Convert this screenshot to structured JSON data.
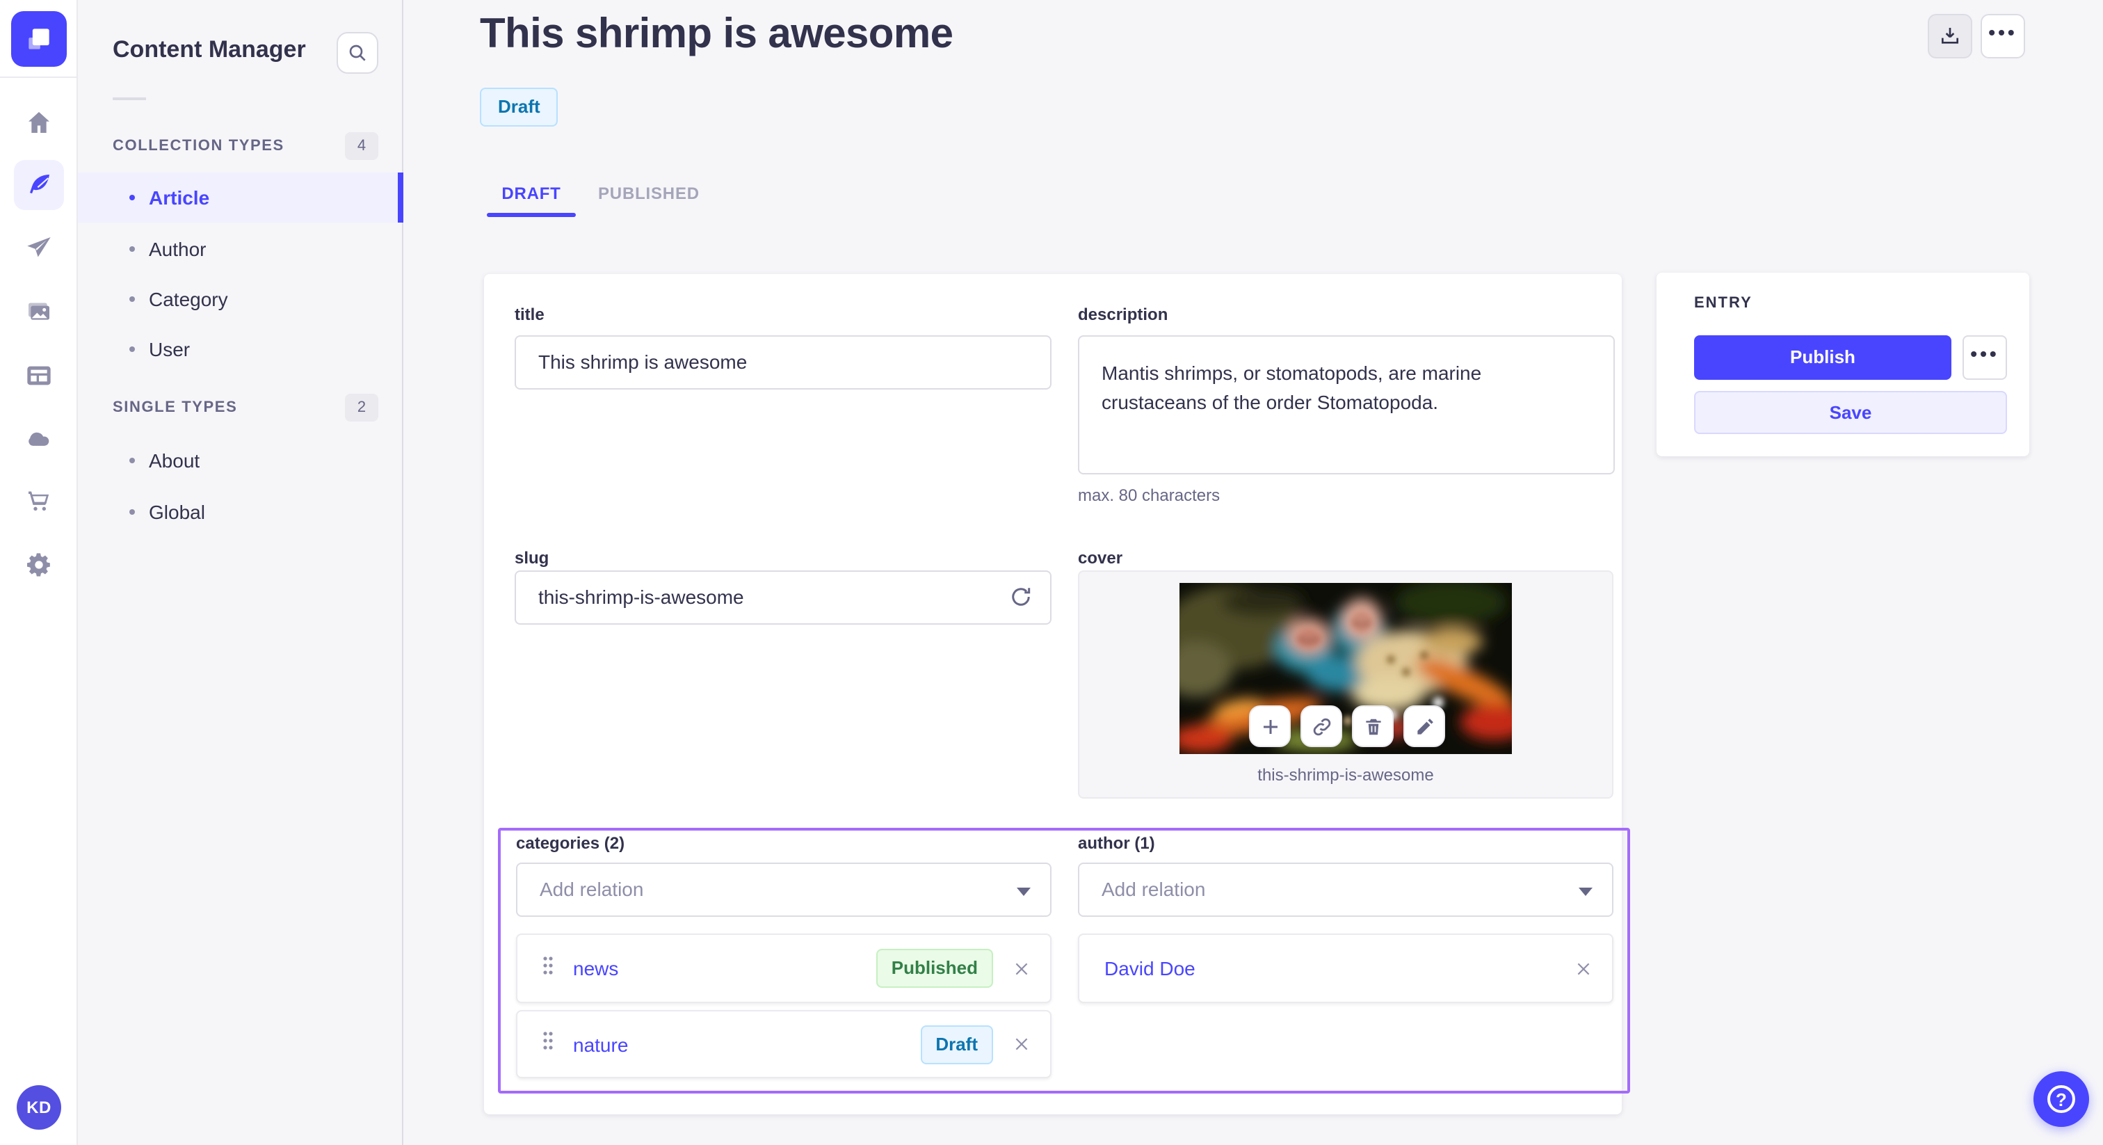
{
  "rail": {
    "logo": "strapi",
    "icons": [
      "home",
      "content-manager",
      "releases",
      "media-library",
      "content-type-builder",
      "deploy",
      "marketplace",
      "settings"
    ],
    "avatar_initials": "KD"
  },
  "subnav": {
    "title": "Content Manager",
    "sections": [
      {
        "label": "COLLECTION TYPES",
        "count": "4",
        "items": [
          {
            "label": "Article"
          },
          {
            "label": "Author"
          },
          {
            "label": "Category"
          },
          {
            "label": "User"
          }
        ]
      },
      {
        "label": "SINGLE TYPES",
        "count": "2",
        "items": [
          {
            "label": "About"
          },
          {
            "label": "Global"
          }
        ]
      }
    ]
  },
  "header": {
    "title": "This shrimp is awesome",
    "status": "Draft",
    "tabs": {
      "draft": "DRAFT",
      "published": "PUBLISHED"
    }
  },
  "form": {
    "title": {
      "label": "title",
      "value": "This shrimp is awesome"
    },
    "description": {
      "label": "description",
      "value": "Mantis shrimps, or stomatopods, are marine crustaceans of the order Stomatopoda.",
      "hint": "max. 80 characters"
    },
    "slug": {
      "label": "slug",
      "value": "this-shrimp-is-awesome"
    },
    "cover": {
      "label": "cover",
      "filename": "this-shrimp-is-awesome"
    },
    "categories": {
      "label": "categories (2)",
      "placeholder": "Add relation",
      "items": [
        {
          "name": "news",
          "status": "Published"
        },
        {
          "name": "nature",
          "status": "Draft"
        }
      ]
    },
    "author": {
      "label": "author (1)",
      "placeholder": "Add relation",
      "items": [
        {
          "name": "David Doe"
        }
      ]
    }
  },
  "entry": {
    "heading": "ENTRY",
    "publish": "Publish",
    "save": "Save"
  },
  "colors": {
    "primary": "#4945FF",
    "primary_light": "#F0F0FF",
    "draft_badge_bg": "#EAF5FF",
    "draft_badge_text": "#0C75AF",
    "published_badge_bg": "#EAFBE7",
    "published_badge_text": "#328048",
    "relation_focus_border": "#A46BFA",
    "text_dark": "#32324D",
    "text_muted": "#666687"
  }
}
